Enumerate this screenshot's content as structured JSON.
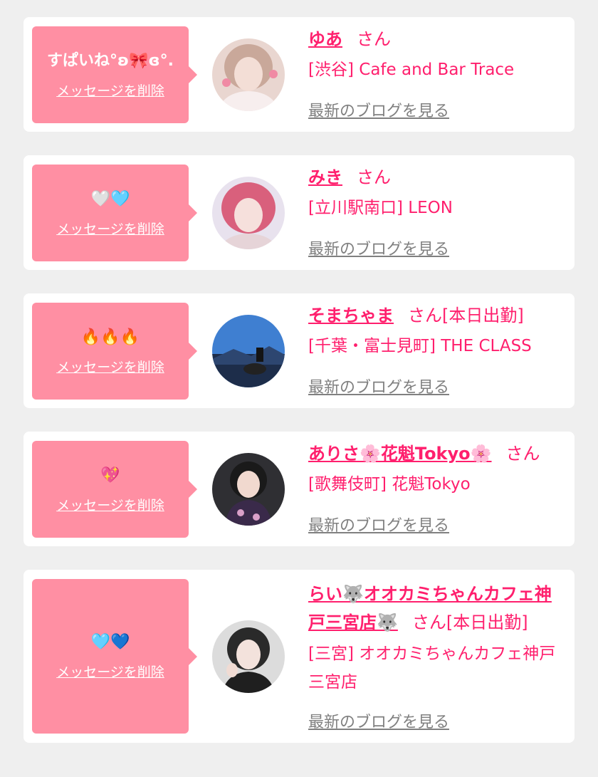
{
  "colors": {
    "accent": "#ff1f6d",
    "bubble": "#ff8fa3",
    "background": "#efefef",
    "link_gray": "#808080"
  },
  "cards": [
    {
      "message": "すぱいね°ʚ🎀ɞ°.",
      "delete_label": "メッセージを削除",
      "name": "ゆあ",
      "san": "さん",
      "shop": "[渋谷] Cafe and Bar Trace",
      "blog_label": "最新のブログを見る",
      "avatar": "avatar-photo-1"
    },
    {
      "message": "🤍🩵",
      "delete_label": "メッセージを削除",
      "name": "みき",
      "san": "さん",
      "shop": "[立川駅南口] LEON",
      "blog_label": "最新のブログを見る",
      "avatar": "avatar-photo-2"
    },
    {
      "message": "🔥🔥🔥",
      "delete_label": "メッセージを削除",
      "name": "そまちゃま",
      "san": "さん[本日出勤]",
      "shop": "[千葉・富士見町] THE CLASS",
      "blog_label": "最新のブログを見る",
      "avatar": "avatar-photo-3"
    },
    {
      "message": "💖",
      "delete_label": "メッセージを削除",
      "name": "ありさ🌸花魁Tokyo🌸",
      "san": "さん",
      "shop": "[歌舞伎町] 花魁Tokyo",
      "blog_label": "最新のブログを見る",
      "avatar": "avatar-photo-4"
    },
    {
      "message": "🩵💙",
      "delete_label": "メッセージを削除",
      "name": "らい🐺オオカミちゃんカフェ神戸三宮店🐺",
      "san": "さん[本日出勤]",
      "shop": "[三宮] オオカミちゃんカフェ神戸三宮店",
      "blog_label": "最新のブログを見る",
      "avatar": "avatar-photo-5"
    }
  ]
}
